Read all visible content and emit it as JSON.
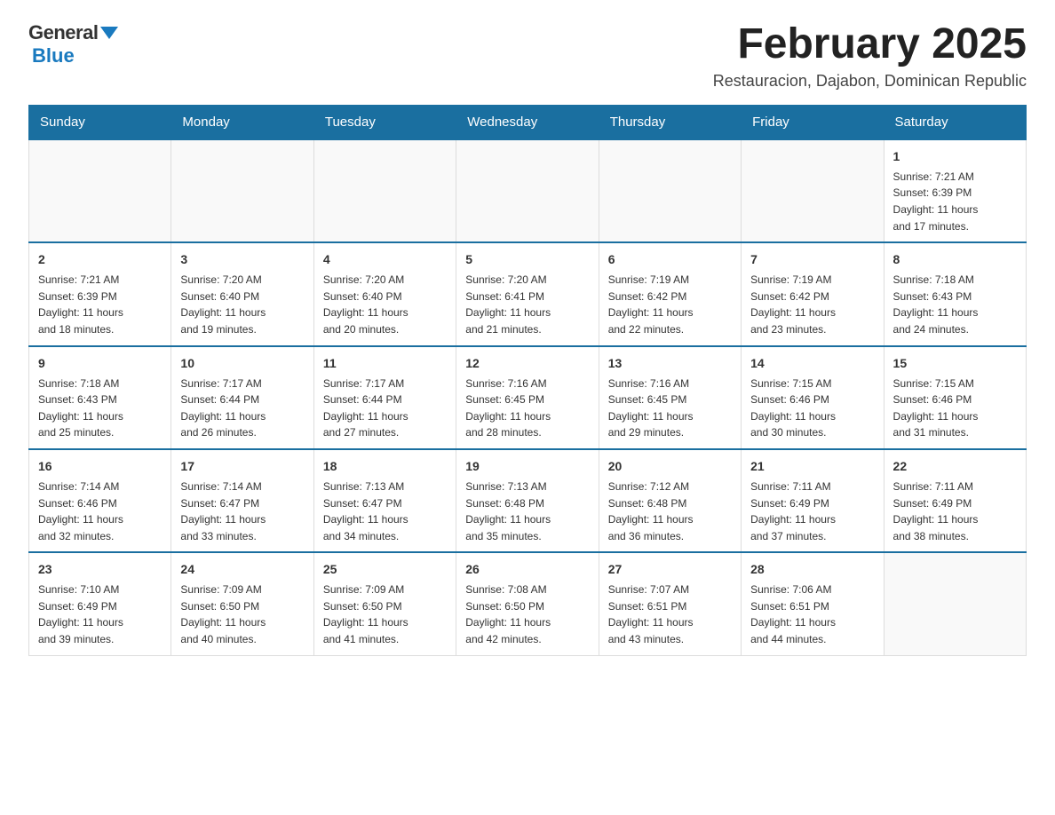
{
  "logo": {
    "general": "General",
    "blue": "Blue"
  },
  "title": "February 2025",
  "subtitle": "Restauracion, Dajabon, Dominican Republic",
  "days_of_week": [
    "Sunday",
    "Monday",
    "Tuesday",
    "Wednesday",
    "Thursday",
    "Friday",
    "Saturday"
  ],
  "weeks": [
    [
      {
        "day": "",
        "info": ""
      },
      {
        "day": "",
        "info": ""
      },
      {
        "day": "",
        "info": ""
      },
      {
        "day": "",
        "info": ""
      },
      {
        "day": "",
        "info": ""
      },
      {
        "day": "",
        "info": ""
      },
      {
        "day": "1",
        "info": "Sunrise: 7:21 AM\nSunset: 6:39 PM\nDaylight: 11 hours\nand 17 minutes."
      }
    ],
    [
      {
        "day": "2",
        "info": "Sunrise: 7:21 AM\nSunset: 6:39 PM\nDaylight: 11 hours\nand 18 minutes."
      },
      {
        "day": "3",
        "info": "Sunrise: 7:20 AM\nSunset: 6:40 PM\nDaylight: 11 hours\nand 19 minutes."
      },
      {
        "day": "4",
        "info": "Sunrise: 7:20 AM\nSunset: 6:40 PM\nDaylight: 11 hours\nand 20 minutes."
      },
      {
        "day": "5",
        "info": "Sunrise: 7:20 AM\nSunset: 6:41 PM\nDaylight: 11 hours\nand 21 minutes."
      },
      {
        "day": "6",
        "info": "Sunrise: 7:19 AM\nSunset: 6:42 PM\nDaylight: 11 hours\nand 22 minutes."
      },
      {
        "day": "7",
        "info": "Sunrise: 7:19 AM\nSunset: 6:42 PM\nDaylight: 11 hours\nand 23 minutes."
      },
      {
        "day": "8",
        "info": "Sunrise: 7:18 AM\nSunset: 6:43 PM\nDaylight: 11 hours\nand 24 minutes."
      }
    ],
    [
      {
        "day": "9",
        "info": "Sunrise: 7:18 AM\nSunset: 6:43 PM\nDaylight: 11 hours\nand 25 minutes."
      },
      {
        "day": "10",
        "info": "Sunrise: 7:17 AM\nSunset: 6:44 PM\nDaylight: 11 hours\nand 26 minutes."
      },
      {
        "day": "11",
        "info": "Sunrise: 7:17 AM\nSunset: 6:44 PM\nDaylight: 11 hours\nand 27 minutes."
      },
      {
        "day": "12",
        "info": "Sunrise: 7:16 AM\nSunset: 6:45 PM\nDaylight: 11 hours\nand 28 minutes."
      },
      {
        "day": "13",
        "info": "Sunrise: 7:16 AM\nSunset: 6:45 PM\nDaylight: 11 hours\nand 29 minutes."
      },
      {
        "day": "14",
        "info": "Sunrise: 7:15 AM\nSunset: 6:46 PM\nDaylight: 11 hours\nand 30 minutes."
      },
      {
        "day": "15",
        "info": "Sunrise: 7:15 AM\nSunset: 6:46 PM\nDaylight: 11 hours\nand 31 minutes."
      }
    ],
    [
      {
        "day": "16",
        "info": "Sunrise: 7:14 AM\nSunset: 6:46 PM\nDaylight: 11 hours\nand 32 minutes."
      },
      {
        "day": "17",
        "info": "Sunrise: 7:14 AM\nSunset: 6:47 PM\nDaylight: 11 hours\nand 33 minutes."
      },
      {
        "day": "18",
        "info": "Sunrise: 7:13 AM\nSunset: 6:47 PM\nDaylight: 11 hours\nand 34 minutes."
      },
      {
        "day": "19",
        "info": "Sunrise: 7:13 AM\nSunset: 6:48 PM\nDaylight: 11 hours\nand 35 minutes."
      },
      {
        "day": "20",
        "info": "Sunrise: 7:12 AM\nSunset: 6:48 PM\nDaylight: 11 hours\nand 36 minutes."
      },
      {
        "day": "21",
        "info": "Sunrise: 7:11 AM\nSunset: 6:49 PM\nDaylight: 11 hours\nand 37 minutes."
      },
      {
        "day": "22",
        "info": "Sunrise: 7:11 AM\nSunset: 6:49 PM\nDaylight: 11 hours\nand 38 minutes."
      }
    ],
    [
      {
        "day": "23",
        "info": "Sunrise: 7:10 AM\nSunset: 6:49 PM\nDaylight: 11 hours\nand 39 minutes."
      },
      {
        "day": "24",
        "info": "Sunrise: 7:09 AM\nSunset: 6:50 PM\nDaylight: 11 hours\nand 40 minutes."
      },
      {
        "day": "25",
        "info": "Sunrise: 7:09 AM\nSunset: 6:50 PM\nDaylight: 11 hours\nand 41 minutes."
      },
      {
        "day": "26",
        "info": "Sunrise: 7:08 AM\nSunset: 6:50 PM\nDaylight: 11 hours\nand 42 minutes."
      },
      {
        "day": "27",
        "info": "Sunrise: 7:07 AM\nSunset: 6:51 PM\nDaylight: 11 hours\nand 43 minutes."
      },
      {
        "day": "28",
        "info": "Sunrise: 7:06 AM\nSunset: 6:51 PM\nDaylight: 11 hours\nand 44 minutes."
      },
      {
        "day": "",
        "info": ""
      }
    ]
  ]
}
